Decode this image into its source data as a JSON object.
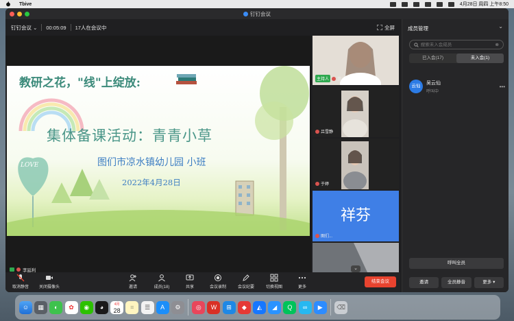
{
  "menubar": {
    "app_name": "Tbive",
    "datetime": "4月28日 周四 上午8:50"
  },
  "window": {
    "title": "钉钉会议"
  },
  "meeting": {
    "name": "钉钉会议",
    "timer": "00:05:09",
    "attendees": "17人在会议中",
    "fullscreen_label": "全屏"
  },
  "slide": {
    "line1": "教研之花，\"线\"上绽放:",
    "line2": "集体备课活动：青青小草",
    "line3": "图们市凉水镇幼儿园  小班",
    "line4": "2022年4月28日",
    "love": "LOVE"
  },
  "speaker": {
    "name": "李延利"
  },
  "tiles": [
    {
      "host_label": "主持人",
      "name": "我"
    },
    {
      "name": "吕雪静"
    },
    {
      "name": "于婷"
    },
    {
      "big_name": "祥芬",
      "name": "图们..."
    }
  ],
  "toolbar": {
    "mute": "取消静音",
    "camera": "关闭摄像头",
    "invite": "邀请",
    "members": "成员(18)",
    "share": "共享",
    "record": "会议录制",
    "minutes": "会议纪要",
    "switch_view": "切换视图",
    "more": "更多",
    "end": "结束会议"
  },
  "panel": {
    "title": "成员管理",
    "search_placeholder": "搜索未入会成员",
    "tab_joined": "已入会(17)",
    "tab_not_joined": "未入会(1)",
    "member": {
      "avatar": "云仙",
      "name": "吴云仙",
      "status": "呼叫中"
    },
    "call_all": "呼叫全员",
    "invite": "邀请",
    "mute_all": "全员静音",
    "more": "更多"
  },
  "dock": {
    "calendar_month": "4月",
    "calendar_day": "28"
  },
  "colors": {
    "accent": "#3f7fe6",
    "end_button": "#e8432f",
    "host_badge": "#2fa84f"
  }
}
